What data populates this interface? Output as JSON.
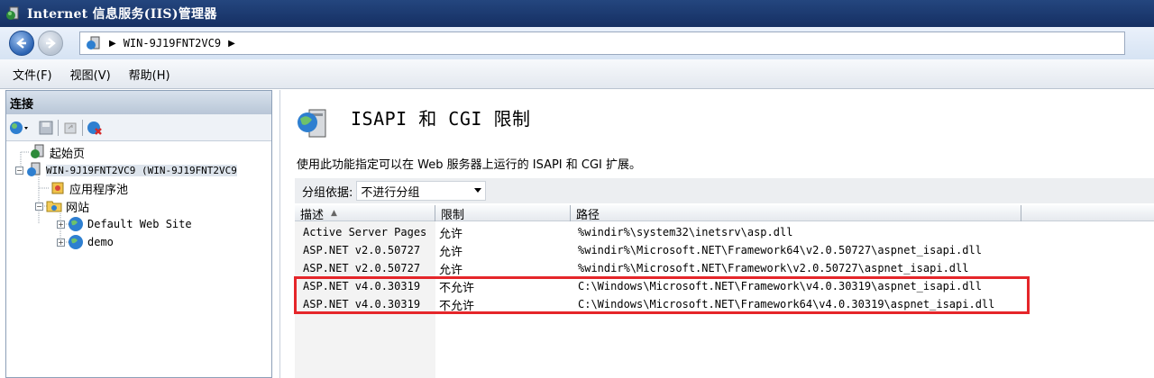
{
  "window": {
    "title": "Internet 信息服务(IIS)管理器"
  },
  "address": {
    "crumbs": [
      "WIN-9J19FNT2VC9"
    ]
  },
  "menu": {
    "items": [
      "文件(F)",
      "视图(V)",
      "帮助(H)"
    ]
  },
  "connections": {
    "header": "连接",
    "tree": [
      {
        "label": "起始页"
      },
      {
        "label": "WIN-9J19FNT2VC9 (WIN-9J19FNT2VC9"
      },
      {
        "label": "应用程序池"
      },
      {
        "label": "网站"
      },
      {
        "label": "Default Web Site"
      },
      {
        "label": "demo"
      }
    ]
  },
  "feature": {
    "title": "ISAPI 和 CGI 限制",
    "description": "使用此功能指定可以在 Web 服务器上运行的 ISAPI 和 CGI 扩展。",
    "group_label": "分组依据:",
    "group_value": "不进行分组",
    "columns": [
      "描述",
      "限制",
      "路径"
    ],
    "rows": [
      {
        "desc": "Active Server Pages",
        "restriction": "允许",
        "path": "%windir%\\system32\\inetsrv\\asp.dll"
      },
      {
        "desc": "ASP.NET v2.0.50727",
        "restriction": "允许",
        "path": "%windir%\\Microsoft.NET\\Framework64\\v2.0.50727\\aspnet_isapi.dll"
      },
      {
        "desc": "ASP.NET v2.0.50727",
        "restriction": "允许",
        "path": "%windir%\\Microsoft.NET\\Framework\\v2.0.50727\\aspnet_isapi.dll"
      },
      {
        "desc": "ASP.NET v4.0.30319",
        "restriction": "不允许",
        "path": "C:\\Windows\\Microsoft.NET\\Framework\\v4.0.30319\\aspnet_isapi.dll"
      },
      {
        "desc": "ASP.NET v4.0.30319",
        "restriction": "不允许",
        "path": "C:\\Windows\\Microsoft.NET\\Framework64\\v4.0.30319\\aspnet_isapi.dll"
      }
    ]
  },
  "colors": {
    "titlebar": "#1d3a70",
    "highlight": "#e5262a"
  }
}
